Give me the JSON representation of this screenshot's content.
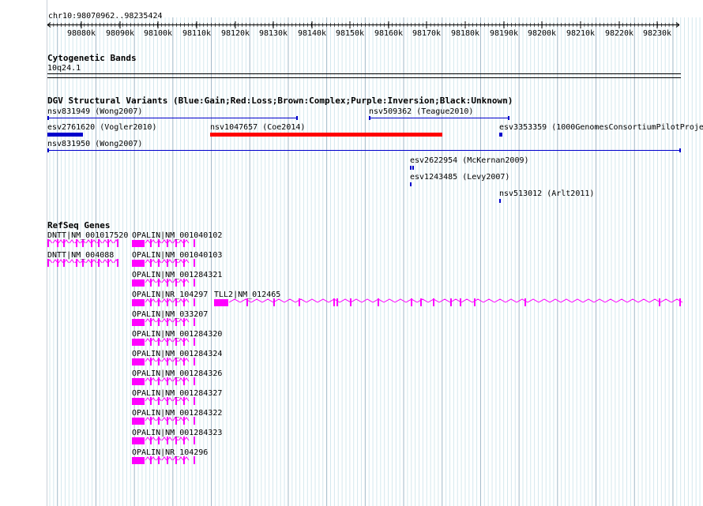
{
  "browser": {
    "location": "chr10:98070962..98235424",
    "ruler_ticks": [
      "98080k",
      "98090k",
      "98100k",
      "98110k",
      "98120k",
      "98130k",
      "98140k",
      "98150k",
      "98160k",
      "98170k",
      "98180k",
      "98190k",
      "98200k",
      "98210k",
      "98220k",
      "98230k"
    ]
  },
  "cytoband_track": {
    "title": "Cytogenetic Bands",
    "band": "10q24.1"
  },
  "dgv_track": {
    "title": "DGV Structural Variants (Blue:Gain;Red:Loss;Brown:Complex;Purple:Inversion;Black:Unknown)",
    "features": [
      {
        "label": "nsv831949 (Wong2007)",
        "color": "#0000cc",
        "style": "line"
      },
      {
        "label": "nsv509362 (Teague2010)",
        "color": "#0000cc",
        "style": "line"
      },
      {
        "label": "esv2761620 (Vogler2010)",
        "color": "#0000cc",
        "style": "bar"
      },
      {
        "label": "nsv1047657 (Coe2014)",
        "color": "#ff0000",
        "style": "bar"
      },
      {
        "label": "esv3353359 (1000GenomesConsortiumPilotProje",
        "color": "#0000cc",
        "style": "bar"
      },
      {
        "label": "nsv831950 (Wong2007)",
        "color": "#0000cc",
        "style": "line"
      },
      {
        "label": "esv2622954 (McKernan2009)",
        "color": "#0000cc",
        "style": "bar"
      },
      {
        "label": "esv1243485 (Levy2007)",
        "color": "#0000cc",
        "style": "bar"
      },
      {
        "label": "nsv513012 (Arlt2011)",
        "color": "#0000cc",
        "style": "bar"
      }
    ]
  },
  "refseq_track": {
    "title": "RefSeq Genes",
    "color": "#ff00ff",
    "genes": [
      {
        "label": "DNTT|NM_001017520"
      },
      {
        "label": "OPALIN|NM_001040102"
      },
      {
        "label": "DNTT|NM_004088"
      },
      {
        "label": "OPALIN|NM_001040103"
      },
      {
        "label": "OPALIN|NM_001284321"
      },
      {
        "label": "OPALIN|NR_104297"
      },
      {
        "label": "TLL2|NM_012465"
      },
      {
        "label": "OPALIN|NM_033207"
      },
      {
        "label": "OPALIN|NM_001284320"
      },
      {
        "label": "OPALIN|NM_001284324"
      },
      {
        "label": "OPALIN|NM_001284326"
      },
      {
        "label": "OPALIN|NM_001284327"
      },
      {
        "label": "OPALIN|NM_001284322"
      },
      {
        "label": "OPALIN|NM_001284323"
      },
      {
        "label": "OPALIN|NR_104296"
      }
    ]
  }
}
